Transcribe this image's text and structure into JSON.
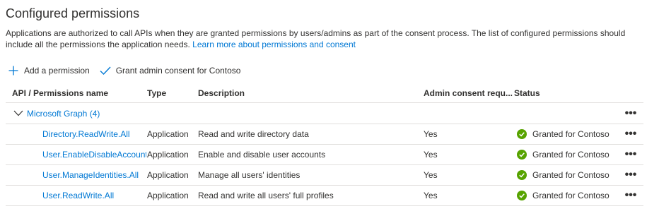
{
  "section": {
    "title": "Configured permissions",
    "description": "Applications are authorized to call APIs when they are granted permissions by users/admins as part of the consent process. The list of configured permissions should include all the permissions the application needs.",
    "learn_more": "Learn more about permissions and consent"
  },
  "toolbar": {
    "add_permission": "Add a permission",
    "grant_consent": "Grant admin consent for Contoso"
  },
  "table": {
    "headers": {
      "api": "API / Permissions name",
      "type": "Type",
      "description": "Description",
      "admin": "Admin consent requ...",
      "status": "Status"
    },
    "group": {
      "name": "Microsoft Graph (4)",
      "more": "•••"
    },
    "rows": [
      {
        "name": "Directory.ReadWrite.All",
        "type": "Application",
        "description": "Read and write directory data",
        "admin": "Yes",
        "status": "Granted for Contoso",
        "more": "•••"
      },
      {
        "name": "User.EnableDisableAccount.A",
        "type": "Application",
        "description": "Enable and disable user accounts",
        "admin": "Yes",
        "status": "Granted for Contoso",
        "more": "•••"
      },
      {
        "name": "User.ManageIdentities.All",
        "type": "Application",
        "description": "Manage all users' identities",
        "admin": "Yes",
        "status": "Granted for Contoso",
        "more": "•••"
      },
      {
        "name": "User.ReadWrite.All",
        "type": "Application",
        "description": "Read and write all users' full profiles",
        "admin": "Yes",
        "status": "Granted for Contoso",
        "more": "•••"
      }
    ]
  },
  "icons": {
    "add": "plus-icon",
    "grant": "checkmark-icon",
    "expand": "chevron-down-icon",
    "status_ok": "success-circle-icon",
    "more": "more-horizontal-icon"
  },
  "colors": {
    "accent": "#0078d4",
    "success": "#57a300",
    "text": "#323130",
    "divider": "#e1dfdd"
  }
}
